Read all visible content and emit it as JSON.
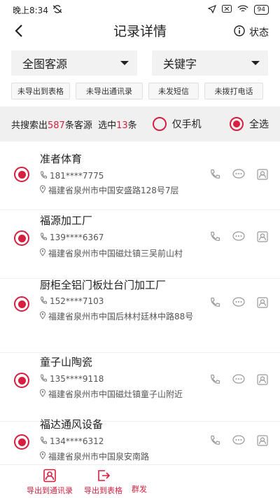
{
  "status_bar": {
    "time": "晚上8:34",
    "battery": "94"
  },
  "navbar": {
    "title": "记录详情",
    "status_label": "状态"
  },
  "dropdowns": [
    {
      "label": "全图客源"
    },
    {
      "label": "关键字"
    }
  ],
  "filters": [
    "未导出到表格",
    "未导出通讯录",
    "未发短信",
    "未拨打电话"
  ],
  "summary": {
    "prefix": "共搜索出",
    "total": "587",
    "middle": "条客源  选中",
    "selected": "13",
    "suffix": "条",
    "phone_only_label": "仅手机",
    "select_all_label": "全选"
  },
  "records": [
    {
      "name": "准者体育",
      "phone": "181****7775",
      "address": "福建省泉州市中国安盛路128号7层"
    },
    {
      "name": "福源加工厂",
      "phone": "139****6367",
      "address": "福建省泉州市中国磁灶镇三吴前山村"
    },
    {
      "name": "厨柜全铝门板灶台门加工厂",
      "phone": "152****7103",
      "address": "福建省泉州市中国后林村廷林中路88号"
    },
    {
      "name": "童子山陶瓷",
      "phone": "135****9118",
      "address": "福建省泉州市中国磁灶镇童子山附近"
    },
    {
      "name": "福达通风设备",
      "phone": "134****6312",
      "address": "福建省泉州市中国泉安南路"
    }
  ],
  "bottom_tabs": [
    {
      "label": "导出到通讯录",
      "icon": "contact-card-icon"
    },
    {
      "label": "导出到表格",
      "icon": "export-icon"
    },
    {
      "label": "群发",
      "icon": "send-icon"
    }
  ],
  "colors": {
    "accent": "#d71f3f",
    "panel": "#f0f0f0"
  }
}
